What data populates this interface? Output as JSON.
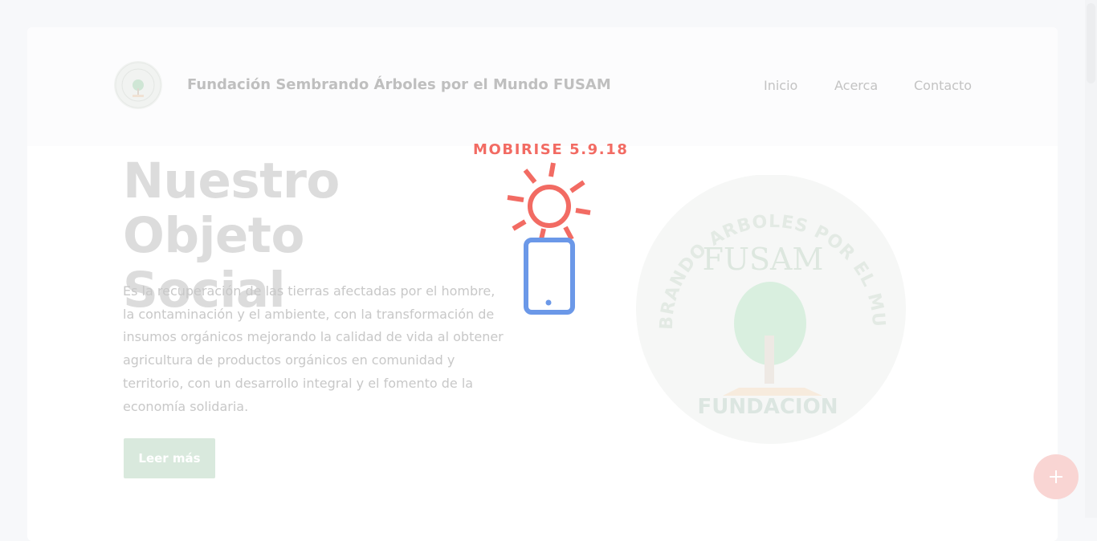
{
  "navbar": {
    "brand_name": "Fundación Sembrando Árboles por el Mundo FUSAM",
    "links": [
      "Inicio",
      "Acerca",
      "Contacto"
    ]
  },
  "hero": {
    "title_line1": "Nuestro Objeto",
    "title_line2": "Social",
    "description": "Es la recuperación de las tierras afectadas por el hombre, la contaminación y el ambiente, con la transformación de insumos orgánicos mejorando la calidad de vida al obtener agricultura de productos orgánicos en comunidad y territorio, con un desarrollo integral y el fomento de la economía solidaria.",
    "button_label": "Leer más"
  },
  "seal": {
    "arc_text": "SEMBRANDO ARBOLES POR EL MUNDO",
    "acronym": "FUSAM",
    "bottom_text": "FUNDACION"
  },
  "badge": {
    "text": "MOBIRISE  5.9.18"
  },
  "icons": {
    "fab": "plus-icon",
    "badge_sun": "sun-icon",
    "badge_phone": "phone-icon"
  },
  "colors": {
    "accent_green": "#d9e9dd",
    "badge_red": "#f26b63",
    "badge_blue": "#6b98e8",
    "fab_pink": "#f9d5d3"
  }
}
